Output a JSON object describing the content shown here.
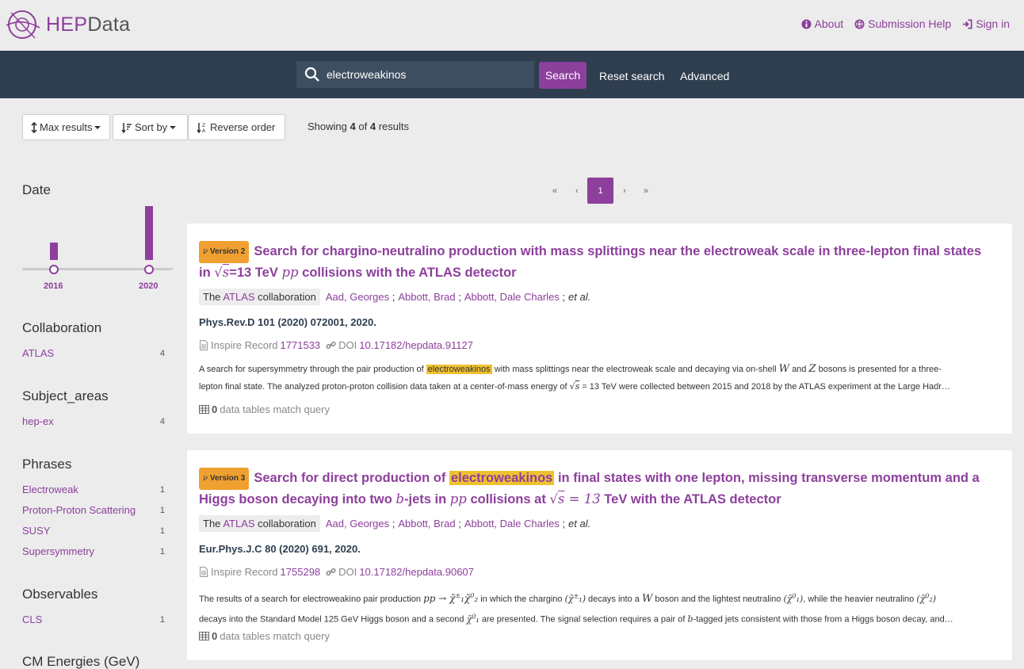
{
  "header": {
    "brand_hep": "HEP",
    "brand_data": "Data",
    "links": [
      {
        "label": "About",
        "icon": "info-circle-icon"
      },
      {
        "label": "Submission Help",
        "icon": "life-ring-icon"
      },
      {
        "label": "Sign in",
        "icon": "sign-in-icon"
      }
    ]
  },
  "search": {
    "query": "electroweakinos",
    "search_label": "Search",
    "reset_label": "Reset search",
    "advanced_label": "Advanced"
  },
  "toolbar": {
    "max_results": "Max results",
    "sort_by": "Sort by",
    "reverse_order": "Reverse order",
    "showing_prefix": "Showing",
    "shown": "4",
    "of": "of",
    "total": "4",
    "results": "results"
  },
  "sidebar": {
    "date": {
      "title": "Date",
      "bars": [
        {
          "year": "2016",
          "count": 1
        },
        {
          "year": "2020",
          "count": 3
        }
      ]
    },
    "collaboration": {
      "title": "Collaboration",
      "items": [
        {
          "label": "ATLAS",
          "count": "4"
        }
      ]
    },
    "subject_areas": {
      "title": "Subject_areas",
      "items": [
        {
          "label": "hep-ex",
          "count": "4"
        }
      ]
    },
    "phrases": {
      "title": "Phrases",
      "items": [
        {
          "label": "Electroweak",
          "count": "1"
        },
        {
          "label": "Proton-Proton Scattering",
          "count": "1"
        },
        {
          "label": "SUSY",
          "count": "1"
        },
        {
          "label": "Supersymmetry",
          "count": "1"
        }
      ]
    },
    "observables": {
      "title": "Observables",
      "items": [
        {
          "label": "CLS",
          "count": "1"
        }
      ]
    },
    "cm_energies": {
      "title": "CM Energies (GeV)"
    }
  },
  "pagination": {
    "first": "«",
    "prev": "‹",
    "current": "1",
    "next": "›",
    "last": "»"
  },
  "results": [
    {
      "version": "Version 2",
      "title_1": "Search for chargino-neutralino production with mass splittings near the electroweak scale in three-lepton final states",
      "title_2a": "in ",
      "title_2b": "=13 TeV ",
      "title_2c": " collisions with the ATLAS detector",
      "collab_the": "The",
      "collab_name": "ATLAS",
      "collab_word": "collaboration",
      "authors": [
        "Aad, Georges",
        "Abbott, Brad",
        "Abbott, Dale Charles"
      ],
      "etal": "et al.",
      "journal": "Phys.Rev.D 101 (2020) 072001, 2020.",
      "inspire_label": "Inspire Record",
      "inspire_id": "1771533",
      "doi_label": "DOI",
      "doi": "10.17182/hepdata.91127",
      "abstract_1a": "A search for supersymmetry through the pair production of",
      "abstract_1hl": "electroweakinos",
      "abstract_1b": "with mass splittings near the electroweak scale and decaying via on-shell",
      "abstract_1c": "and",
      "abstract_1d": "bosons is presented for a three-",
      "abstract_2a": "lepton final state. The analyzed proton-proton collision data taken at a center-of-mass energy of",
      "abstract_2b": "= 13 TeV were collected between 2015 and 2018 by the ATLAS experiment at the Large Hadr…",
      "tables_count": "0",
      "tables_label": "data tables match query"
    },
    {
      "version": "Version 3",
      "title_1a": "Search for direct production of",
      "title_1hl": "electroweakinos",
      "title_1b": "in final states with one lepton, missing transverse momentum and a",
      "title_2a": "Higgs boson decaying into two ",
      "title_2b": "-jets in ",
      "title_2c": " collisions at ",
      "title_2d": " = 13",
      "title_2e": " TeV with the ATLAS detector",
      "collab_the": "The",
      "collab_name": "ATLAS",
      "collab_word": "collaboration",
      "authors": [
        "Aad, Georges",
        "Abbott, Brad",
        "Abbott, Dale Charles"
      ],
      "etal": "et al.",
      "journal": "Eur.Phys.J.C 80 (2020) 691, 2020.",
      "inspire_label": "Inspire Record",
      "inspire_id": "1755298",
      "doi_label": "DOI",
      "doi": "10.17182/hepdata.90607",
      "abstract_1a": "The results of a search for electroweakino pair production",
      "abstract_1b": "in which the chargino",
      "abstract_1c": "decays into a",
      "abstract_1d": "boson and the lightest neutralino",
      "abstract_1e": ", while the heavier neutralino",
      "abstract_2a": "decays into the Standard Model 125 GeV Higgs boson and a second",
      "abstract_2b": "are presented. The signal selection requires a pair of",
      "abstract_2c": "-tagged jets consistent with those from a Higgs boson decay, and…",
      "tables_count": "0",
      "tables_label": "data tables match query"
    }
  ],
  "colors": {
    "accent": "#8d3f9c",
    "navbar": "#2e3e4f",
    "highlight": "#f0c030",
    "version_badge": "#f0a030"
  }
}
